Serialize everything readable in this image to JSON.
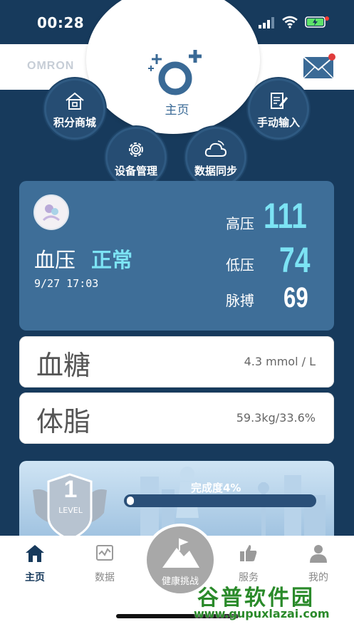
{
  "status_bar": {
    "time": "00:28"
  },
  "header": {
    "logo": "OMRON",
    "home_label": "主页"
  },
  "quick_actions": {
    "points_mall": "积分商城",
    "manual_input": "手动输入",
    "device_manage": "设备管理",
    "data_sync": "数据同步"
  },
  "blood_pressure": {
    "title": "血压",
    "status": "正常",
    "date": "9/27  17:03",
    "systolic_label": "高压",
    "systolic": "111",
    "diastolic_label": "低压",
    "diastolic": "74",
    "pulse_label": "脉搏",
    "pulse": "69"
  },
  "blood_sugar": {
    "title": "血糖",
    "value": "4.3 mmol / L"
  },
  "body_fat": {
    "title": "体脂",
    "value": "59.3kg/33.6%"
  },
  "challenge": {
    "level_number": "1",
    "level_text": "LEVEL",
    "completion": "完成度4%",
    "progress": 0.04
  },
  "nav": {
    "home": "主页",
    "data": "数据",
    "challenge": "健康挑战",
    "service": "服务",
    "mine": "我的"
  },
  "watermark": {
    "brand": "谷普软件园",
    "url": "www.gupuxlazai.com"
  },
  "colors": {
    "accent": "#7ce3f4",
    "primary": "#173a5c",
    "card": "#3e6e98"
  }
}
